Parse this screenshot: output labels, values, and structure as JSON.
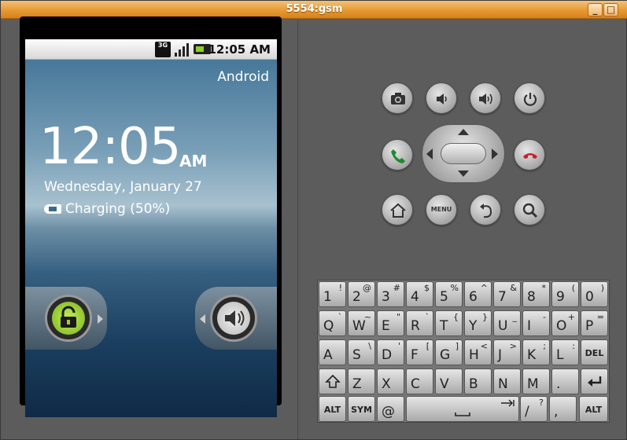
{
  "window": {
    "title": "5554:gsm",
    "minimize": "_",
    "maximize": "□",
    "close": "✕"
  },
  "status_bar": {
    "network": "3G",
    "time": "12:05 AM"
  },
  "lockscreen": {
    "carrier": "Android",
    "clock": "12:05",
    "ampm": "AM",
    "date": "Wednesday, January 27",
    "charging": "Charging (50%)"
  },
  "controls": {
    "menu_label": "MENU"
  },
  "keyboard": {
    "row1": [
      {
        "m": "1",
        "s": "!"
      },
      {
        "m": "2",
        "s": "@"
      },
      {
        "m": "3",
        "s": "#"
      },
      {
        "m": "4",
        "s": "$"
      },
      {
        "m": "5",
        "s": "%"
      },
      {
        "m": "6",
        "s": "^"
      },
      {
        "m": "7",
        "s": "&"
      },
      {
        "m": "8",
        "s": "*"
      },
      {
        "m": "9",
        "s": "("
      },
      {
        "m": "0",
        "s": ")"
      }
    ],
    "row2": [
      {
        "m": "Q",
        "s": "`"
      },
      {
        "m": "W",
        "s": "~"
      },
      {
        "m": "E",
        "s": "\""
      },
      {
        "m": "R",
        "s": "`"
      },
      {
        "m": "T",
        "s": "{"
      },
      {
        "m": "Y",
        "s": "}"
      },
      {
        "m": "U",
        "s": "_"
      },
      {
        "m": "I",
        "s": "-"
      },
      {
        "m": "O",
        "s": "+"
      },
      {
        "m": "P",
        "s": "="
      }
    ],
    "row3": [
      {
        "m": "A",
        "s": ""
      },
      {
        "m": "S",
        "s": "\\"
      },
      {
        "m": "D",
        "s": "'"
      },
      {
        "m": "F",
        "s": "["
      },
      {
        "m": "G",
        "s": "]"
      },
      {
        "m": "H",
        "s": "<"
      },
      {
        "m": "J",
        "s": ">"
      },
      {
        "m": "K",
        "s": ";"
      },
      {
        "m": "L",
        "s": ":"
      }
    ],
    "del": "DEL",
    "row4": [
      "Z",
      "X",
      "C",
      "V",
      "B",
      "N",
      "M",
      "."
    ],
    "alt": "ALT",
    "sym": "SYM",
    "at": "@",
    "slash": "/",
    "slash_sub": "?",
    "comma": ","
  }
}
